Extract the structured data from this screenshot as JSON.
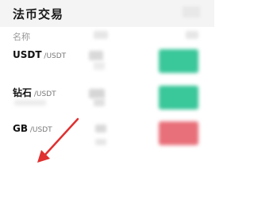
{
  "header": {
    "title": "法币交易"
  },
  "list": {
    "column_name": "名称",
    "rows": [
      {
        "base": "USDT",
        "quote": " /USDT",
        "action_color": "#3ac79a"
      },
      {
        "base": "钻石",
        "quote": " /USDT",
        "action_color": "#3ac79a"
      },
      {
        "base": "GB",
        "quote": " /USDT",
        "action_color": "#e8707a"
      }
    ]
  },
  "annotation": {
    "arrow_color": "#e03030"
  }
}
